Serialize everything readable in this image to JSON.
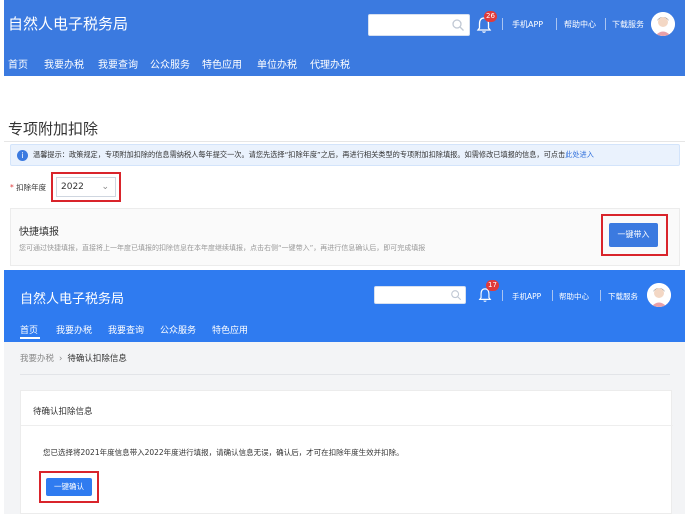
{
  "panel1": {
    "app_title": "自然人电子税务局",
    "notification_count": "26",
    "header_links": [
      "手机APP",
      "帮助中心",
      "下载服务"
    ],
    "nav": [
      "首页",
      "我要办税",
      "我要查询",
      "公众服务",
      "特色应用",
      "单位办税",
      "代理办税"
    ],
    "page_heading": "专项附加扣除",
    "notice": {
      "text": "温馨提示：政策规定，专项附加扣除的信息需纳税人每年提交一次。请您先选择“扣除年度”之后，再进行相关类型的专项附加扣除填报。如需修改已填报的信息，可点击",
      "link": "此处进入"
    },
    "year_field": {
      "required_mark": "*",
      "label": "扣除年度",
      "value": "2022"
    },
    "quick_fill": {
      "title": "快捷填报",
      "description": "您可通过快捷填报，直接将上一年度已填报的扣除信息在本年度继续填报，点击右侧“一键带入”，再进行信息确认后，即可完成填报",
      "button": "一键带入"
    }
  },
  "panel2": {
    "app_title": "自然人电子税务局",
    "notification_count": "17",
    "header_links": [
      "手机APP",
      "帮助中心",
      "下载服务"
    ],
    "nav": [
      "首页",
      "我要办税",
      "我要查询",
      "公众服务",
      "特色应用"
    ],
    "active_nav": "首页",
    "breadcrumb": {
      "parent": "我要办税",
      "current": "待确认扣除信息"
    },
    "card": {
      "title": "待确认扣除信息",
      "message": "您已选择将2021年度信息带入2022年度进行填报，请确认信息无误，确认后，才可在扣除年度生效并扣除。",
      "button": "一键确认"
    }
  },
  "colors": {
    "header_blue_1": "#3b7ae0",
    "header_blue_2": "#2f7bf0",
    "highlight_red": "#d9242b",
    "badge_red": "#e03b3b",
    "link_blue": "#2f6fdb"
  },
  "icons": [
    "search-icon",
    "bell-icon",
    "avatar-icon",
    "info-icon",
    "chevron-down-icon",
    "chevron-right-icon"
  ]
}
